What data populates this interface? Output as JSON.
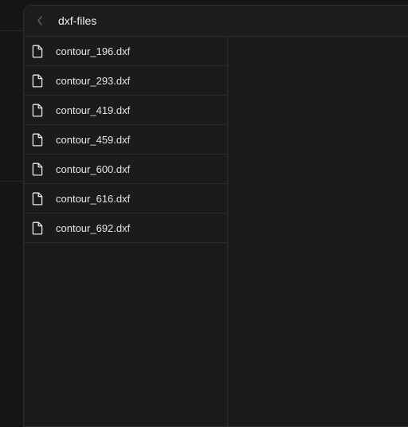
{
  "window": {
    "title": "dxf-files",
    "back_icon": "chevron-left-icon"
  },
  "files": [
    {
      "name": "contour_196.dxf",
      "icon": "file-icon"
    },
    {
      "name": "contour_293.dxf",
      "icon": "file-icon"
    },
    {
      "name": "contour_419.dxf",
      "icon": "file-icon"
    },
    {
      "name": "contour_459.dxf",
      "icon": "file-icon"
    },
    {
      "name": "contour_600.dxf",
      "icon": "file-icon"
    },
    {
      "name": "contour_616.dxf",
      "icon": "file-icon"
    },
    {
      "name": "contour_692.dxf",
      "icon": "file-icon"
    }
  ],
  "colors": {
    "background": "#151515",
    "panel": "#1b1b1b",
    "divider": "#2c2c2c",
    "text": "#e6e6e6"
  }
}
